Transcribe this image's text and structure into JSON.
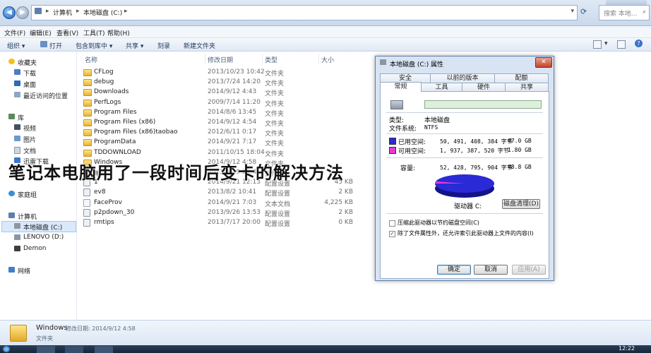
{
  "address": {
    "crumbs": [
      "计算机",
      "本地磁盘 (C:)"
    ],
    "separator": "▸",
    "search_placeholder": "搜索 本地..."
  },
  "menu": [
    "文件(F)",
    "编辑(E)",
    "查看(V)",
    "工具(T)",
    "帮助(H)"
  ],
  "toolbar": {
    "organize": "组织 ▾",
    "open": "打开",
    "include": "包含到库中 ▾",
    "share": "共享 ▾",
    "burn": "刻录",
    "new_folder": "新建文件夹"
  },
  "nav": {
    "favorites": "收藏夹",
    "downloads": "下载",
    "desktop": "桌面",
    "recent": "最近访问的位置",
    "libraries": "库",
    "videos": "视频",
    "pictures": "图片",
    "documents": "文档",
    "xunlei": "迅雷下载",
    "homegroup": "家庭组",
    "computer": "计算机",
    "local_disk": "本地磁盘 (C:)",
    "lenovo": "LENOVO (D:)",
    "demon": "Demon",
    "network": "网络"
  },
  "columns": {
    "name": "名称",
    "date": "修改日期",
    "type": "类型",
    "size": "大小"
  },
  "files": [
    {
      "name": "CFLog",
      "date": "2013/10/23 10:42",
      "type": "文件夹",
      "size": "",
      "kind": "folder"
    },
    {
      "name": "debug",
      "date": "2013/7/24 14:20",
      "type": "文件夹",
      "size": "",
      "kind": "folder"
    },
    {
      "name": "Downloads",
      "date": "2014/9/12 4:43",
      "type": "文件夹",
      "size": "",
      "kind": "folder"
    },
    {
      "name": "PerfLogs",
      "date": "2009/7/14 11:20",
      "type": "文件夹",
      "size": "",
      "kind": "folder"
    },
    {
      "name": "Program Files",
      "date": "2014/8/6 13:45",
      "type": "文件夹",
      "size": "",
      "kind": "folder"
    },
    {
      "name": "Program Files (x86)",
      "date": "2014/9/12 4:54",
      "type": "文件夹",
      "size": "",
      "kind": "folder"
    },
    {
      "name": "Program Files (x86)taobao",
      "date": "2012/6/11 0:17",
      "type": "文件夹",
      "size": "",
      "kind": "folder"
    },
    {
      "name": "ProgramData",
      "date": "2014/9/21 7:17",
      "type": "文件夹",
      "size": "",
      "kind": "folder"
    },
    {
      "name": "TDDOWNLOAD",
      "date": "2011/10/15 18:04",
      "type": "文件夹",
      "size": "",
      "kind": "folder"
    },
    {
      "name": "Windows",
      "date": "2014/9/12 4:58",
      "type": "文件夹",
      "size": "",
      "kind": "folder"
    },
    {
      "name": "用户",
      "date": "2013/6/19 23:41",
      "type": "文件夹",
      "size": "",
      "kind": "folder"
    },
    {
      "name": "1",
      "date": "2014/9/21 12:13",
      "type": "配置设置",
      "size": "45 KB",
      "kind": "cfg"
    },
    {
      "name": "ev8",
      "date": "2013/8/2 10:41",
      "type": "配置设置",
      "size": "2 KB",
      "kind": "cfg"
    },
    {
      "name": "FaceProv",
      "date": "2014/9/21 7:03",
      "type": "文本文档",
      "size": "4,225 KB",
      "kind": "doc"
    },
    {
      "name": "p2pdown_30",
      "date": "2013/9/26 13:53",
      "type": "配置设置",
      "size": "2 KB",
      "kind": "cfg"
    },
    {
      "name": "rmtips",
      "date": "2013/7/17 20:00",
      "type": "配置设置",
      "size": "0 KB",
      "kind": "cfg"
    }
  ],
  "overlay_title": "笔记本电脑用了一段时间后变卡的解决方法",
  "dialog": {
    "title": "本地磁盘 (C:) 属性",
    "close": "✕",
    "tabs_row1": [
      "安全",
      "以前的版本",
      "配额"
    ],
    "tabs_row2": [
      "常规",
      "工具",
      "硬件",
      "共享"
    ],
    "type_label": "类型:",
    "type_value": "本地磁盘",
    "fs_label": "文件系统:",
    "fs_value": "NTFS",
    "used_label": "已用空间:",
    "used_bytes": "50, 491, 408, 384 字节",
    "used_gb": "47.0 GB",
    "free_label": "可用空间:",
    "free_bytes": "1, 937, 387, 520 字节",
    "free_gb": "1.80 GB",
    "capacity_label": "容量:",
    "capacity_bytes": "52, 428, 795, 904 字节",
    "capacity_gb": "48.8 GB",
    "drive_label": "驱动器 C:",
    "cleanup": "磁盘清理(D)",
    "compress_label": "压缩此驱动器以节约磁盘空间(C)",
    "index_label": "除了文件属性外，还允许索引此驱动器上文件的内容(I)",
    "index_checked": "✓",
    "ok": "确定",
    "cancel": "取消",
    "apply": "应用(A)",
    "used_color": "#2a2ad6",
    "free_color": "#e63ad6",
    "used_fraction": 0.963
  },
  "details": {
    "name": "Windows",
    "modified": "修改日期: 2014/9/12 4:58",
    "type": "文件夹"
  },
  "taskbar": {
    "time": "12:22"
  }
}
